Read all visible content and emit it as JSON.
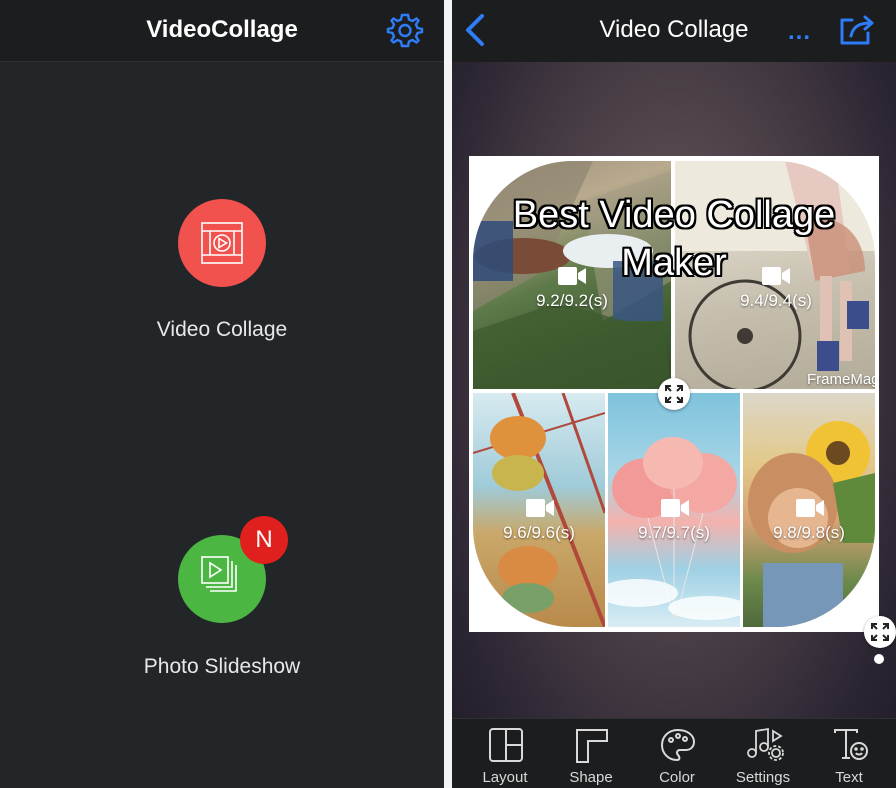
{
  "left_screen": {
    "title": "VideoCollage",
    "video_collage_label": "Video Collage",
    "photo_slideshow_label": "Photo Slideshow",
    "new_badge": "N",
    "colors": {
      "video_collage": "#f1524d",
      "photo_slideshow": "#4cb643",
      "badge": "#e0201d",
      "accent": "#2e7cf6"
    }
  },
  "right_screen": {
    "title": "Video Collage",
    "more_label": "...",
    "headline_line1": "Best Video Collage",
    "headline_line2": "Maker",
    "watermark": "FrameMag",
    "tiles": [
      {
        "duration": "9.2/9.2(s)"
      },
      {
        "duration": "9.4/9.4(s)"
      },
      {
        "duration": "9.6/9.6(s)"
      },
      {
        "duration": "9.7/9.7(s)"
      },
      {
        "duration": "9.8/9.8(s)"
      }
    ],
    "tabs": [
      {
        "label": "Layout",
        "icon": "layout-icon"
      },
      {
        "label": "Shape",
        "icon": "shape-icon"
      },
      {
        "label": "Color",
        "icon": "palette-icon"
      },
      {
        "label": "Settings",
        "icon": "music-settings-icon"
      },
      {
        "label": "Text",
        "icon": "text-icon"
      }
    ]
  }
}
